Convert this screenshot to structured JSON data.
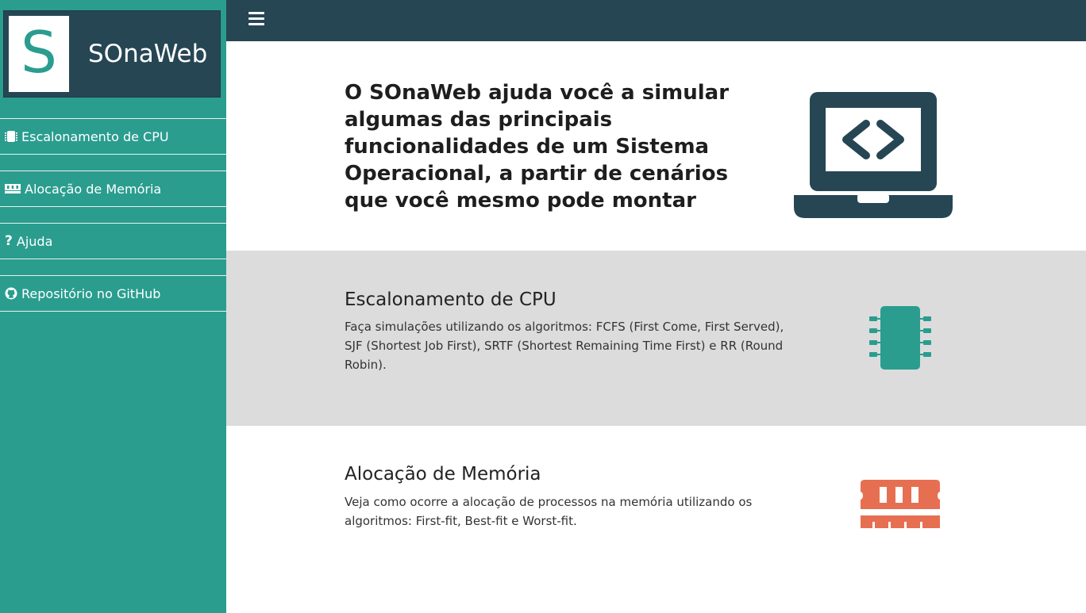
{
  "brand": {
    "letter": "S",
    "name": "SOnaWeb"
  },
  "sidebar": {
    "items": [
      {
        "label": "Escalonamento de CPU",
        "icon": "microchip-icon"
      },
      {
        "label": "Alocação de Memória",
        "icon": "memory-icon"
      },
      {
        "label": "Ajuda",
        "icon": "question-icon"
      },
      {
        "label": "Repositório no GitHub",
        "icon": "github-icon"
      }
    ]
  },
  "topbar": {
    "menu_icon": "hamburger-icon"
  },
  "hero": {
    "title": "O SOnaWeb ajuda você a simular algumas das principais funcionalidades de um Sistema Operacional, a partir de cenários que você mesmo pode montar",
    "icon": "laptop-code-icon"
  },
  "sections": {
    "cpu": {
      "title": "Escalonamento de CPU",
      "text": "Faça simulações utilizando os algoritmos: FCFS (First Come, First Served), SJF (Shortest Job First), SRTF (Shortest Remaining Time First) e RR (Round Robin).",
      "icon": "microchip-icon"
    },
    "memory": {
      "title": "Alocação de Memória",
      "text": "Veja como ocorre a alocação de processos na memória utilizando os algoritmos: First-fit, Best-fit e Worst-fit.",
      "icon": "memory-icon"
    }
  },
  "colors": {
    "sidebar": "#2a9d8f",
    "dark": "#264653",
    "accent_orange": "#e76f51",
    "section_gray": "#dcdcdc"
  }
}
